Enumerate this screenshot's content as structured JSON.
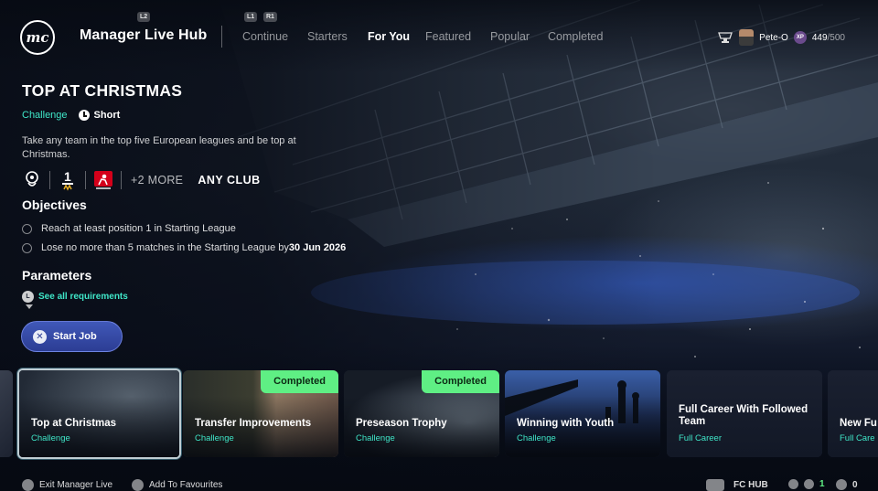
{
  "header": {
    "logo_text": "mc",
    "title": "Manager Live Hub",
    "hint_left": "L2",
    "hint_l1": "L1",
    "hint_r1": "R1",
    "tabs": [
      {
        "label": "Continue"
      },
      {
        "label": "Starters"
      },
      {
        "label": "For You",
        "active": true
      },
      {
        "label": "Featured"
      },
      {
        "label": "Popular"
      },
      {
        "label": "Completed"
      }
    ],
    "username": "Pete-O",
    "xp_icon_text": "XP",
    "xp_current": "449",
    "xp_max": "/500"
  },
  "job": {
    "title": "TOP AT CHRISTMAS",
    "type": "Challenge",
    "duration": "Short",
    "description": "Take any team in the top five European leagues and be top at Christmas.",
    "leagues": [
      "premier-league-logo",
      "ligue-1-logo",
      "bundesliga-logo"
    ],
    "more_label": "+2 MORE",
    "any_club_label": "ANY CLUB"
  },
  "objectives": {
    "heading": "Objectives",
    "items": [
      {
        "text": "Reach at least position 1 in Starting League",
        "bold": ""
      },
      {
        "text": "Lose no more than 5 matches in the Starting League by ",
        "bold": "30 Jun 2026"
      }
    ]
  },
  "parameters": {
    "heading": "Parameters",
    "button_hint": "L",
    "see_all_label": "See all requirements"
  },
  "start_button": {
    "hint": "✕",
    "label": "Start Job"
  },
  "cards": [
    {
      "title": "Top at Christmas",
      "type": "Challenge",
      "completed": false,
      "selected": true
    },
    {
      "title": "Transfer Improvements",
      "type": "Challenge",
      "completed": true,
      "badge": "Completed"
    },
    {
      "title": "Preseason Trophy",
      "type": "Challenge",
      "completed": true,
      "badge": "Completed"
    },
    {
      "title": "Winning with Youth",
      "type": "Challenge",
      "completed": false
    },
    {
      "title": "Full Career With Followed Team",
      "type": "Full Career",
      "completed": false
    },
    {
      "title": "New Fu",
      "type": "Full Care",
      "completed": false
    }
  ],
  "footer": {
    "exit_label": "Exit Manager Live",
    "fav_label": "Add To Favourites",
    "fc_hub_label": "FC HUB",
    "online_count": "1",
    "friends_count": "0"
  },
  "colors": {
    "accent_teal": "#3fe6c8",
    "completed_badge": "#5fef84",
    "start_button": "#3a50b0"
  }
}
